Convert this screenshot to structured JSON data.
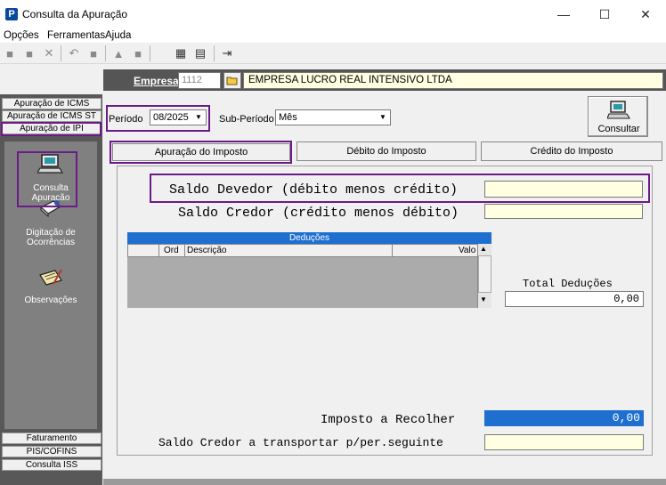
{
  "window": {
    "title": "Consulta da Apuração",
    "minimize": "—",
    "maximize": "☐",
    "close": "✕",
    "app_icon_letter": "P"
  },
  "menu": [
    "Opções",
    "Ferramentas",
    "Ajuda"
  ],
  "empresa": {
    "label": "Empresa",
    "code": "1112",
    "name": "EMPRESA LUCRO REAL INTENSIVO LTDA"
  },
  "sidebar": {
    "tabs_top": [
      "Apuração de ICMS",
      "Apuração de ICMS ST",
      "Apuração de IPI"
    ],
    "nav_items": [
      {
        "label": "Consulta\nApuração",
        "icon": "computer-icon"
      },
      {
        "label": "Digitação de\nOcorrências",
        "icon": "typing-icon"
      },
      {
        "label": "Observações",
        "icon": "notebook-icon"
      }
    ],
    "tabs_bottom": [
      "Faturamento",
      "PIS/COFINS",
      "Consulta ISS"
    ]
  },
  "filters": {
    "periodo_label": "Período",
    "periodo_value": "08/2025",
    "subperiodo_label": "Sub-Período",
    "subperiodo_value": "Mês",
    "consultar_label": "Consultar"
  },
  "tabs": [
    "Apuração do Imposto",
    "Débito do Imposto",
    "Crédito do Imposto"
  ],
  "panel": {
    "saldo_devedor_label": "Saldo Devedor (débito menos crédito)",
    "saldo_devedor_value": "",
    "saldo_credor_label": "Saldo Credor (crédito menos débito)",
    "saldo_credor_value": "",
    "deducoes": {
      "title": "Deduções",
      "columns": [
        "Ord",
        "Descrição",
        "Valo"
      ]
    },
    "total_deducoes_label": "Total Deduções",
    "total_deducoes_value": "0,00",
    "imposto_label": "Imposto a Recolher",
    "imposto_value": "0,00",
    "saldo_transportar_label": "Saldo Credor a transportar p/per.seguinte",
    "saldo_transportar_value": ""
  },
  "colors": {
    "highlight": "#6a1b8a",
    "grid_header": "#1e6fd0",
    "imposto_field": "#1e6fd0",
    "yellow_field": "#ffffe1"
  }
}
